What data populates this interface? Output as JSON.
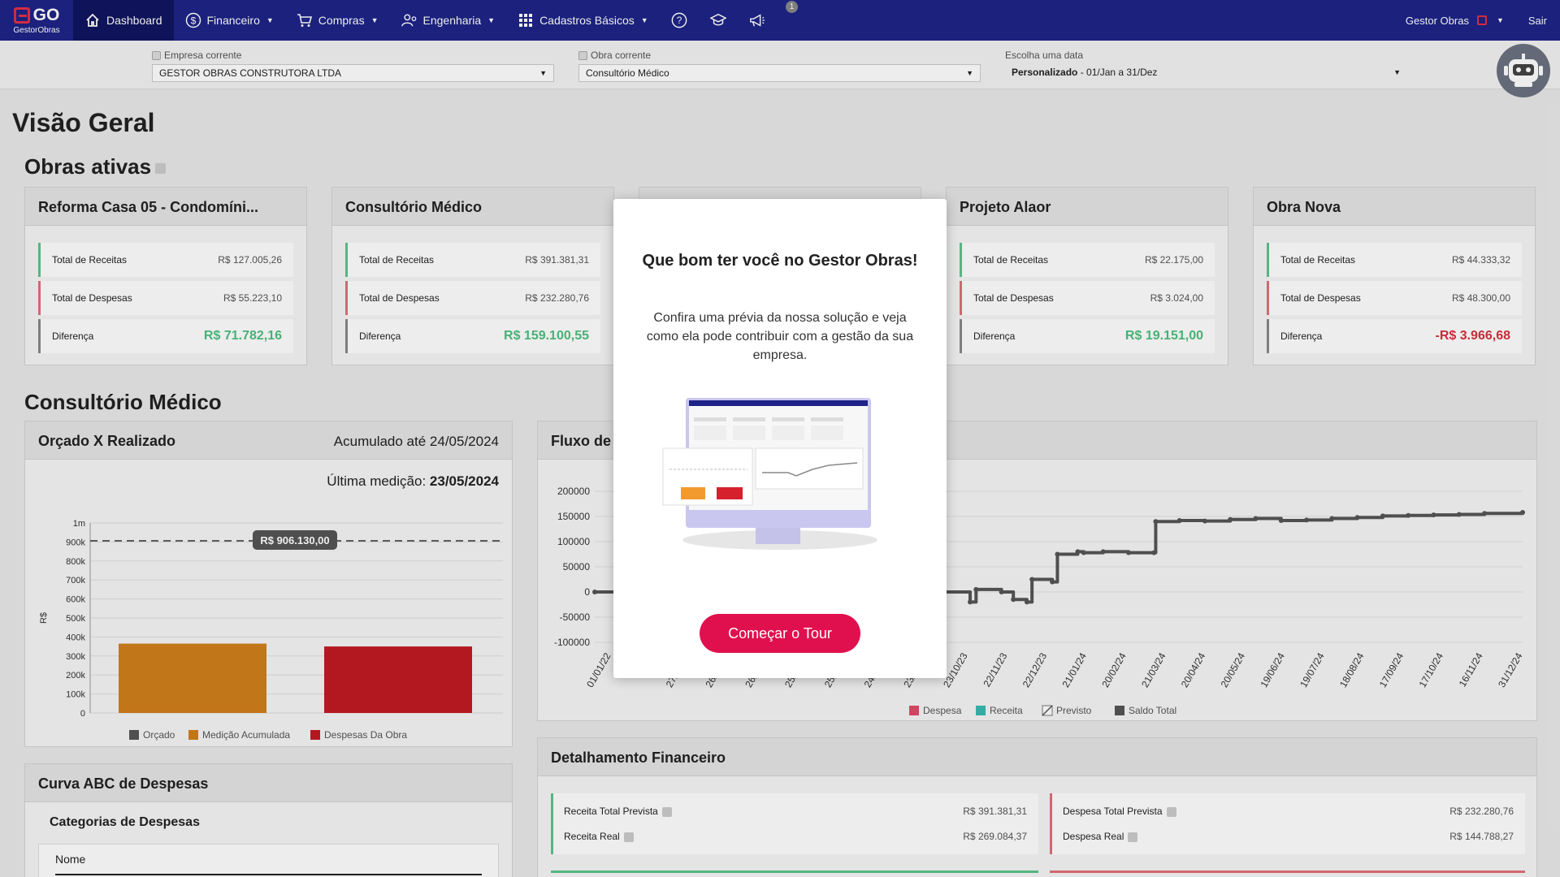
{
  "nav": {
    "logo_text": "GO",
    "logo_sub": "GestorObras",
    "items": [
      {
        "label": "Dashboard",
        "icon": "home-icon"
      },
      {
        "label": "Financeiro",
        "icon": "dollar-icon"
      },
      {
        "label": "Compras",
        "icon": "cart-icon"
      },
      {
        "label": "Engenharia",
        "icon": "engineer-icon"
      },
      {
        "label": "Cadastros Básicos",
        "icon": "grid-icon"
      }
    ],
    "notification_count": "1",
    "user_name": "Gestor Obras",
    "logout": "Sair"
  },
  "filters": {
    "company_label": "Empresa corrente",
    "company_value": "GESTOR OBRAS CONSTRUTORA LTDA",
    "project_label": "Obra corrente",
    "project_value": "Consultório Médico",
    "date_label": "Escolha uma data",
    "date_value_bold": "Personalizado",
    "date_value_rest": " - 01/Jan a 31/Dez"
  },
  "page_title": "Visão Geral",
  "active_title": "Obras ativas",
  "labels": {
    "receitas": "Total de Receitas",
    "despesas": "Total de Despesas",
    "diferenca": "Diferença"
  },
  "projects": [
    {
      "name": "Reforma Casa 05 - Condomíni...",
      "receitas": "R$ 127.005,26",
      "despesas": "R$ 55.223,10",
      "diferenca": "R$ 71.782,16",
      "neg": false
    },
    {
      "name": "Consultório Médico",
      "receitas": "R$ 391.381,31",
      "despesas": "R$ 232.280,76",
      "diferenca": "R$ 159.100,55",
      "neg": false
    },
    {
      "name": "",
      "receitas": "",
      "despesas": "",
      "diferenca": "",
      "neg": false
    },
    {
      "name": "Projeto Alaor",
      "receitas": "R$ 22.175,00",
      "despesas": "R$ 3.024,00",
      "diferenca": "R$ 19.151,00",
      "neg": false
    },
    {
      "name": "Obra Nova",
      "receitas": "R$ 44.333,32",
      "despesas": "R$ 48.300,00",
      "diferenca": "-R$ 3.966,68",
      "neg": true
    }
  ],
  "section_title": "Consultório Médico",
  "orcado": {
    "title": "Orçado X Realizado",
    "acumulado": "Acumulado até 24/05/2024",
    "ultima_label": "Última medição: ",
    "ultima_value": "23/05/2024",
    "budget_tooltip": "R$ 906.130,00"
  },
  "fluxo": {
    "title": "Fluxo de Caixa"
  },
  "abc": {
    "title": "Curva ABC de Despesas",
    "subtitle": "Categorias de Despesas",
    "col_name": "Nome"
  },
  "detalhamento": {
    "title": "Detalhamento Financeiro",
    "receita_prevista_label": "Receita Total Prevista",
    "receita_prevista": "R$ 391.381,31",
    "receita_real_label": "Receita Real",
    "receita_real": "R$ 269.084,37",
    "despesa_prevista_label": "Despesa Total Prevista",
    "despesa_prevista": "R$ 232.280,76",
    "despesa_real_label": "Despesa Real",
    "despesa_real": "R$ 144.788,27"
  },
  "modal": {
    "title": "Que bom ter você no Gestor Obras!",
    "description": "Confira uma prévia da nossa solução e veja como ela pode contribuir com a gestão da sua empresa.",
    "button": "Começar o Tour"
  },
  "colors": {
    "nav": "#1e2487",
    "orcado": "#555555",
    "medicao": "#d17f1c",
    "despesas": "#c11a24",
    "positive": "#4dbf7e",
    "negative": "#d7303d",
    "cta": "#e0104e"
  },
  "chart_data": [
    {
      "type": "bar",
      "ylabel": "R$",
      "y_ticks": [
        "0",
        "100k",
        "200k",
        "300k",
        "400k",
        "500k",
        "600k",
        "700k",
        "800k",
        "900k",
        "1m"
      ],
      "ylim": [
        0,
        1000000
      ],
      "reference_line": {
        "value": 906130,
        "label": "R$ 906.130,00"
      },
      "categories": [
        "Medição Acumulada",
        "Despesas Da Obra"
      ],
      "series": [
        {
          "name": "Orçado",
          "color": "#555555",
          "values": [
            0,
            0
          ]
        },
        {
          "name": "Medição Acumulada",
          "color": "#d17f1c",
          "values": [
            365000,
            0
          ]
        },
        {
          "name": "Despesas Da Obra",
          "color": "#c11a24",
          "values": [
            0,
            350000
          ]
        }
      ],
      "legend": [
        "Orçado",
        "Medição Acumulada",
        "Despesas Da Obra"
      ]
    },
    {
      "type": "line",
      "y_ticks": [
        "200000",
        "150000",
        "100000",
        "50000",
        "0",
        "-50000",
        "-100000"
      ],
      "ylim": [
        -100000,
        200000
      ],
      "x_ticks": [
        "01/01/22",
        "31/01/",
        "27/03/23",
        "26/04/23",
        "26/05/23",
        "25/06/23",
        "25/07/23",
        "24/08/23",
        "23/09/23",
        "23/10/23",
        "22/11/23",
        "22/12/23",
        "21/01/24",
        "20/02/24",
        "21/03/24",
        "20/04/24",
        "20/05/24",
        "19/06/24",
        "19/07/24",
        "18/08/24",
        "17/09/24",
        "17/10/24",
        "16/11/24",
        "31/12/24"
      ],
      "legend": [
        "Despesa",
        "Receita",
        "Previsto",
        "Saldo Total"
      ],
      "series": [
        {
          "name": "Saldo Total",
          "color": "#555555",
          "x": [
            "01/01/22",
            "31/01/22",
            "20/03/23",
            "27/03/23",
            "26/04/23",
            "10/05/23",
            "26/05/23",
            "01/06/23",
            "25/06/23",
            "01/07/23",
            "25/07/23",
            "01/08/23",
            "24/08/23",
            "23/09/23",
            "23/10/23",
            "25/10/23",
            "22/11/23",
            "22/12/23",
            "21/01/24",
            "20/02/24",
            "21/03/24",
            "20/04/24",
            "20/05/24",
            "19/06/24",
            "19/07/24",
            "18/08/24",
            "17/09/24",
            "17/10/24",
            "16/11/24",
            "31/12/24"
          ],
          "values": [
            0,
            0,
            -20000,
            5000,
            0,
            -15000,
            -20000,
            25000,
            20000,
            75000,
            80000,
            78000,
            80000,
            78000,
            78000,
            140000,
            142000,
            141000,
            144000,
            146000,
            142000,
            143000,
            146000,
            148000,
            151000,
            152000,
            153000,
            154000,
            156000,
            158000
          ]
        }
      ]
    }
  ]
}
